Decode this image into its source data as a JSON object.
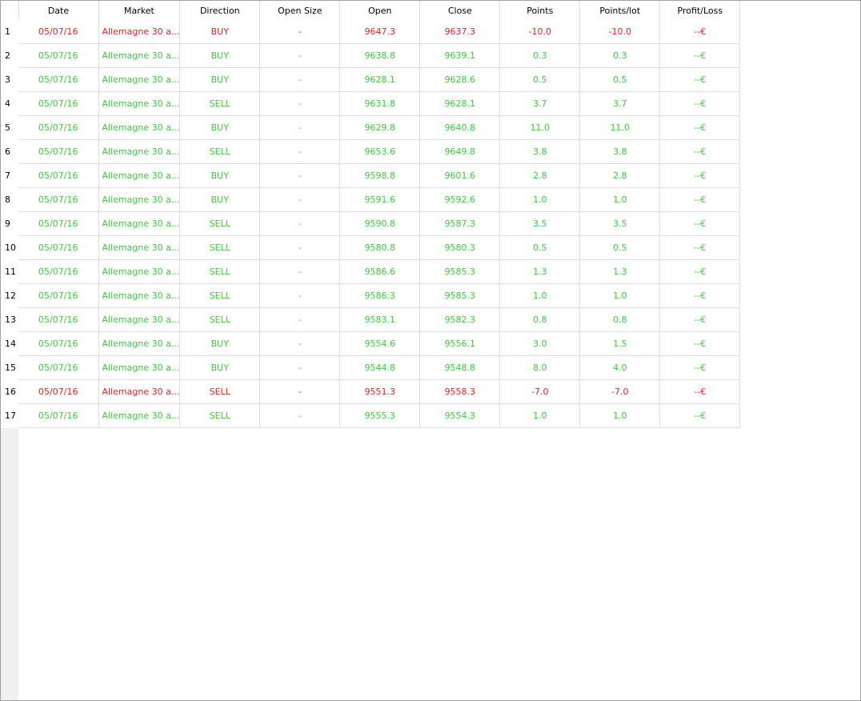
{
  "columns": [
    "Date",
    "Market",
    "Direction",
    "Open Size",
    "Open",
    "Close",
    "Points",
    "Points/lot",
    "Profit/Loss"
  ],
  "colors": {
    "win": "#3ec73e",
    "loss": "#e02222"
  },
  "rows": [
    {
      "n": "1",
      "date": "05/07/16",
      "market": "Allemagne 30 a...",
      "direction": "BUY",
      "open_size": "-",
      "open": "9647.3",
      "close": "9637.3",
      "points": "-10.0",
      "points_lot": "-10.0",
      "pl": "--€",
      "status": "loss"
    },
    {
      "n": "2",
      "date": "05/07/16",
      "market": "Allemagne 30 a...",
      "direction": "BUY",
      "open_size": "-",
      "open": "9638.8",
      "close": "9639.1",
      "points": "0.3",
      "points_lot": "0.3",
      "pl": "--€",
      "status": "win"
    },
    {
      "n": "3",
      "date": "05/07/16",
      "market": "Allemagne 30 a...",
      "direction": "BUY",
      "open_size": "-",
      "open": "9628.1",
      "close": "9628.6",
      "points": "0.5",
      "points_lot": "0.5",
      "pl": "--€",
      "status": "win"
    },
    {
      "n": "4",
      "date": "05/07/16",
      "market": "Allemagne 30 a...",
      "direction": "SELL",
      "open_size": "-",
      "open": "9631.8",
      "close": "9628.1",
      "points": "3.7",
      "points_lot": "3.7",
      "pl": "--€",
      "status": "win"
    },
    {
      "n": "5",
      "date": "05/07/16",
      "market": "Allemagne 30 a...",
      "direction": "BUY",
      "open_size": "-",
      "open": "9629.8",
      "close": "9640.8",
      "points": "11.0",
      "points_lot": "11.0",
      "pl": "--€",
      "status": "win"
    },
    {
      "n": "6",
      "date": "05/07/16",
      "market": "Allemagne 30 a...",
      "direction": "SELL",
      "open_size": "-",
      "open": "9653.6",
      "close": "9649.8",
      "points": "3.8",
      "points_lot": "3.8",
      "pl": "--€",
      "status": "win"
    },
    {
      "n": "7",
      "date": "05/07/16",
      "market": "Allemagne 30 a...",
      "direction": "BUY",
      "open_size": "-",
      "open": "9598.8",
      "close": "9601.6",
      "points": "2.8",
      "points_lot": "2.8",
      "pl": "--€",
      "status": "win"
    },
    {
      "n": "8",
      "date": "05/07/16",
      "market": "Allemagne 30 a...",
      "direction": "BUY",
      "open_size": "-",
      "open": "9591.6",
      "close": "9592.6",
      "points": "1.0",
      "points_lot": "1.0",
      "pl": "--€",
      "status": "win"
    },
    {
      "n": "9",
      "date": "05/07/16",
      "market": "Allemagne 30 a...",
      "direction": "SELL",
      "open_size": "-",
      "open": "9590.8",
      "close": "9587.3",
      "points": "3.5",
      "points_lot": "3.5",
      "pl": "--€",
      "status": "win"
    },
    {
      "n": "10",
      "date": "05/07/16",
      "market": "Allemagne 30 a...",
      "direction": "SELL",
      "open_size": "-",
      "open": "9580.8",
      "close": "9580.3",
      "points": "0.5",
      "points_lot": "0.5",
      "pl": "--€",
      "status": "win"
    },
    {
      "n": "11",
      "date": "05/07/16",
      "market": "Allemagne 30 a...",
      "direction": "SELL",
      "open_size": "-",
      "open": "9586.6",
      "close": "9585.3",
      "points": "1.3",
      "points_lot": "1.3",
      "pl": "--€",
      "status": "win"
    },
    {
      "n": "12",
      "date": "05/07/16",
      "market": "Allemagne 30 a...",
      "direction": "SELL",
      "open_size": "-",
      "open": "9586.3",
      "close": "9585.3",
      "points": "1.0",
      "points_lot": "1.0",
      "pl": "--€",
      "status": "win"
    },
    {
      "n": "13",
      "date": "05/07/16",
      "market": "Allemagne 30 a...",
      "direction": "SELL",
      "open_size": "-",
      "open": "9583.1",
      "close": "9582.3",
      "points": "0.8",
      "points_lot": "0.8",
      "pl": "--€",
      "status": "win"
    },
    {
      "n": "14",
      "date": "05/07/16",
      "market": "Allemagne 30 a...",
      "direction": "BUY",
      "open_size": "-",
      "open": "9554.6",
      "close": "9556.1",
      "points": "3.0",
      "points_lot": "1.5",
      "pl": "--€",
      "status": "win"
    },
    {
      "n": "15",
      "date": "05/07/16",
      "market": "Allemagne 30 a...",
      "direction": "BUY",
      "open_size": "-",
      "open": "9544.8",
      "close": "9548.8",
      "points": "8.0",
      "points_lot": "4.0",
      "pl": "--€",
      "status": "win"
    },
    {
      "n": "16",
      "date": "05/07/16",
      "market": "Allemagne 30 a...",
      "direction": "SELL",
      "open_size": "-",
      "open": "9551.3",
      "close": "9558.3",
      "points": "-7.0",
      "points_lot": "-7.0",
      "pl": "--€",
      "status": "loss"
    },
    {
      "n": "17",
      "date": "05/07/16",
      "market": "Allemagne 30 a...",
      "direction": "SELL",
      "open_size": "-",
      "open": "9555.3",
      "close": "9554.3",
      "points": "1.0",
      "points_lot": "1.0",
      "pl": "--€",
      "status": "win"
    }
  ]
}
